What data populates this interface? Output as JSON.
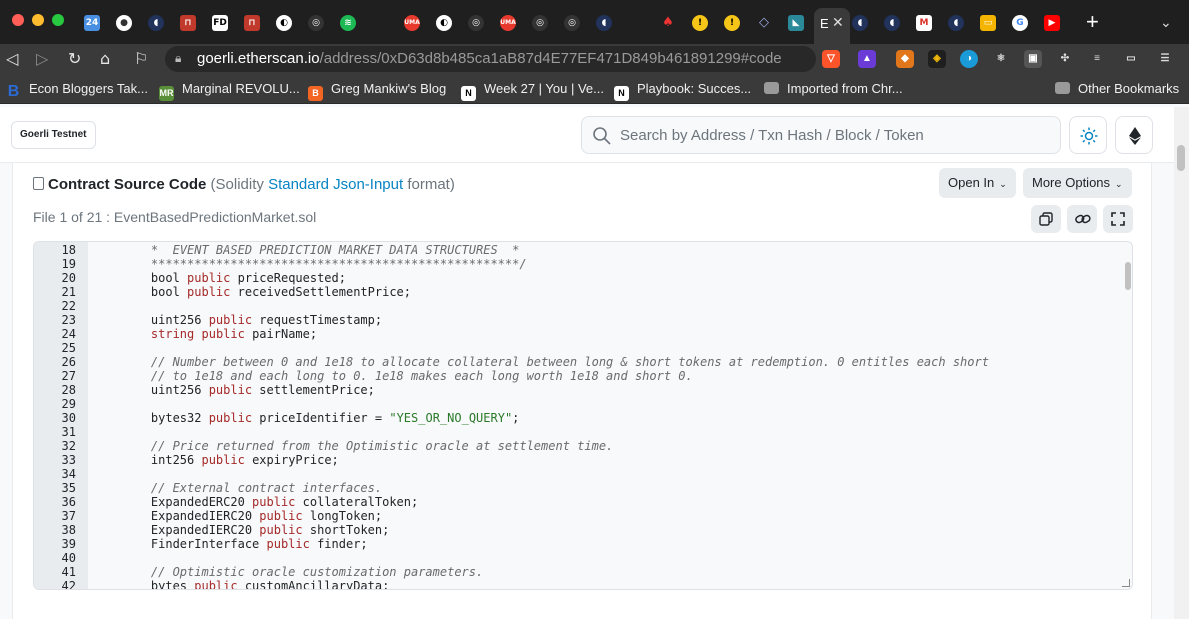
{
  "browser": {
    "url_host": "goerli.etherscan.io",
    "url_path": "/address/0xD63d8b485ca1aB87d4E77EF471D849b461891299#code",
    "active_tab_label": "E",
    "bookmarks": [
      {
        "label": "Econ Bloggers Tak...",
        "icon": "bookmark-b-icon",
        "color": "#2b6bd6"
      },
      {
        "label": "Marginal REVOLU...",
        "icon": "bookmark-mr-icon",
        "color": "#5a8f3a"
      },
      {
        "label": "Greg Mankiw's Blog",
        "icon": "bookmark-blogger-icon",
        "color": "#f26522"
      },
      {
        "label": "Week 27 | You | Ve...",
        "icon": "bookmark-notion-icon",
        "color": "#ffffff"
      },
      {
        "label": "Playbook: Succes...",
        "icon": "bookmark-notion-icon",
        "color": "#ffffff"
      },
      {
        "label": "Imported from Chr...",
        "icon": "folder-icon",
        "color": "#9a9a9a"
      }
    ],
    "other_bookmarks": "Other Bookmarks"
  },
  "header": {
    "network": "Goerli Testnet",
    "search_placeholder": "Search by Address / Txn Hash / Block / Token"
  },
  "contract": {
    "title_bold": "Contract Source Code",
    "title_pre": "(Solidity ",
    "title_link": "Standard Json-Input",
    "title_post": " format)",
    "open_in": "Open In",
    "more_options": "More Options",
    "file_info": "File 1 of 21 : EventBasedPredictionMarket.sol"
  },
  "code_lines": [
    {
      "n": "18",
      "html": "<span class=\"cm\">    *  EVENT BASED PREDICTION MARKET DATA STRUCTURES  *</span>"
    },
    {
      "n": "19",
      "html": "<span class=\"cm\">    ***************************************************/</span>"
    },
    {
      "n": "20",
      "html": "    bool <span class=\"kw\">public</span> priceRequested;"
    },
    {
      "n": "21",
      "html": "    bool <span class=\"kw\">public</span> receivedSettlementPrice;"
    },
    {
      "n": "22",
      "html": ""
    },
    {
      "n": "23",
      "html": "    uint256 <span class=\"kw\">public</span> requestTimestamp;"
    },
    {
      "n": "24",
      "html": "    <span class=\"kw\">string</span> <span class=\"kw\">public</span> pairName;"
    },
    {
      "n": "25",
      "html": ""
    },
    {
      "n": "26",
      "html": "<span class=\"cm\">    // Number between 0 and 1e18 to allocate collateral between long &amp; short tokens at redemption. 0 entitles each short</span>"
    },
    {
      "n": "27",
      "html": "<span class=\"cm\">    // to 1e18 and each long to 0. 1e18 makes each long worth 1e18 and short 0.</span>"
    },
    {
      "n": "28",
      "html": "    uint256 <span class=\"kw\">public</span> settlementPrice;"
    },
    {
      "n": "29",
      "html": ""
    },
    {
      "n": "30",
      "html": "    bytes32 <span class=\"kw\">public</span> priceIdentifier = <span class=\"str\">\"YES_OR_NO_QUERY\"</span>;"
    },
    {
      "n": "31",
      "html": ""
    },
    {
      "n": "32",
      "html": "<span class=\"cm\">    // Price returned from the Optimistic oracle at settlement time.</span>"
    },
    {
      "n": "33",
      "html": "    int256 <span class=\"kw\">public</span> expiryPrice;"
    },
    {
      "n": "34",
      "html": ""
    },
    {
      "n": "35",
      "html": "<span class=\"cm\">    // External contract interfaces.</span>"
    },
    {
      "n": "36",
      "html": "    ExpandedERC20 <span class=\"kw\">public</span> collateralToken;"
    },
    {
      "n": "37",
      "html": "    ExpandedIERC20 <span class=\"kw\">public</span> longToken;"
    },
    {
      "n": "38",
      "html": "    ExpandedIERC20 <span class=\"kw\">public</span> shortToken;"
    },
    {
      "n": "39",
      "html": "    FinderInterface <span class=\"kw\">public</span> finder;"
    },
    {
      "n": "40",
      "html": ""
    },
    {
      "n": "41",
      "html": "<span class=\"cm\">    // Optimistic oracle customization parameters.</span>"
    },
    {
      "n": "42",
      "html": "    bytes <span class=\"kw\">public</span> customAncillaryData;"
    }
  ]
}
